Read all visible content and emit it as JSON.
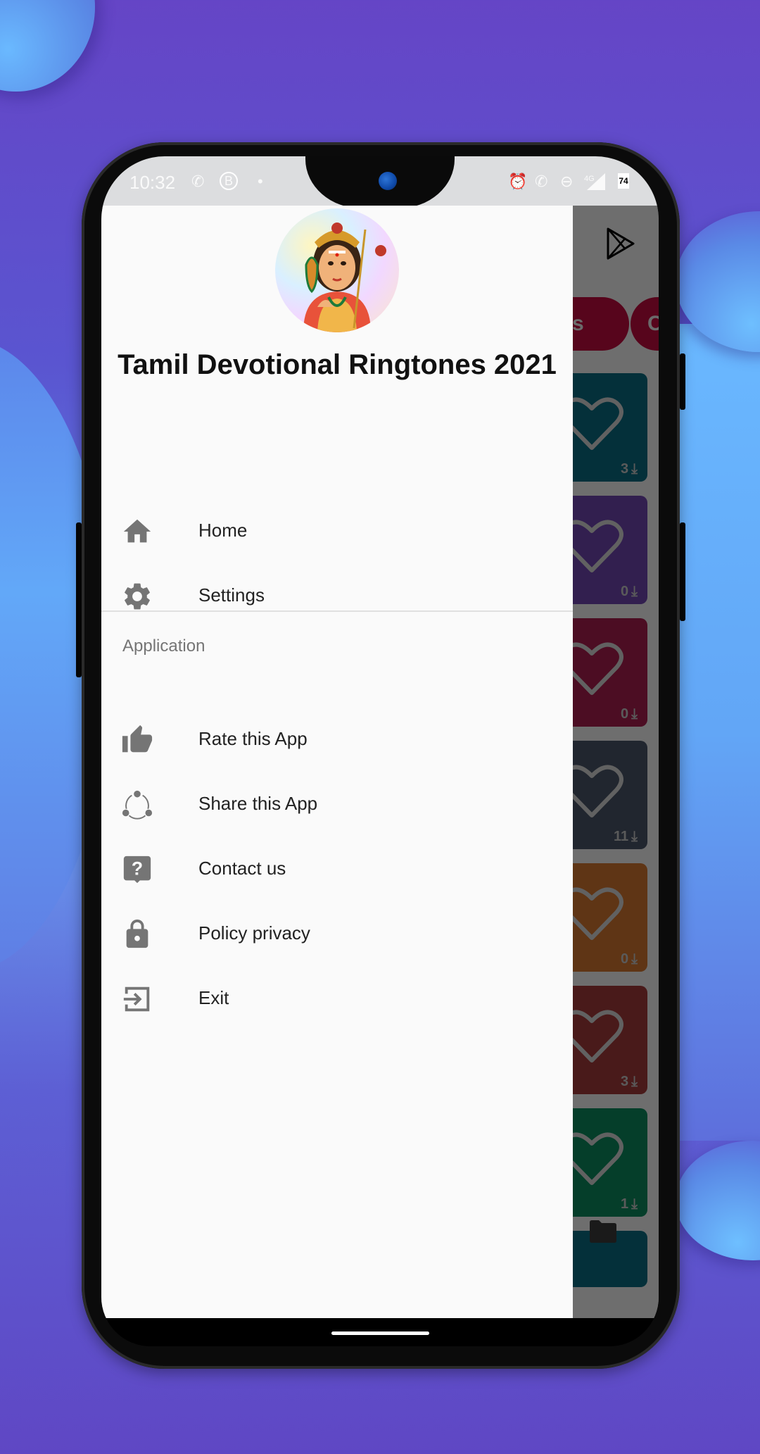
{
  "status_bar": {
    "time": "10:32",
    "left_icons": [
      "phone-icon",
      "whatsapp-business-icon",
      "dot-icon"
    ],
    "right_icons": [
      "alarm-icon",
      "wifi-call-icon",
      "do-not-disturb-icon",
      "signal-4g-icon"
    ],
    "network_label": "4G",
    "battery": "74"
  },
  "drawer": {
    "app_title": "Tamil Devotional Ringtones 2021",
    "avatar": "murugan-deity-avatar",
    "primary_items": [
      {
        "label": "Home",
        "icon": "home-icon"
      },
      {
        "label": "Settings",
        "icon": "gear-icon"
      }
    ],
    "section_label": "Application",
    "secondary_items": [
      {
        "label": "Rate this App",
        "icon": "thumbs-up-icon"
      },
      {
        "label": "Share this App",
        "icon": "share-icon"
      },
      {
        "label": "Contact us",
        "icon": "help-bubble-icon"
      },
      {
        "label": "Policy privacy",
        "icon": "lock-icon"
      },
      {
        "label": "Exit",
        "icon": "exit-icon"
      }
    ]
  },
  "background_app": {
    "header_icon": "play-store-icon",
    "chips": [
      "nes",
      "C"
    ],
    "ringtone_cards": [
      {
        "downloads": "3",
        "color": "#0b6b80"
      },
      {
        "downloads": "0",
        "color": "#7046b0"
      },
      {
        "downloads": "0",
        "color": "#a91e4e"
      },
      {
        "downloads": "11",
        "color": "#4a5568"
      },
      {
        "downloads": "0",
        "color": "#d27530"
      },
      {
        "downloads": "3",
        "color": "#a33a3a"
      },
      {
        "downloads": "1",
        "color": "#0d8a5e"
      },
      {
        "downloads": "",
        "color": "#0b6b80"
      }
    ],
    "bottom_icon": "folder-icon"
  },
  "colors": {
    "chip": "#c00d3f",
    "drawer_bg": "#fafafa",
    "icon_gray": "#757575"
  }
}
